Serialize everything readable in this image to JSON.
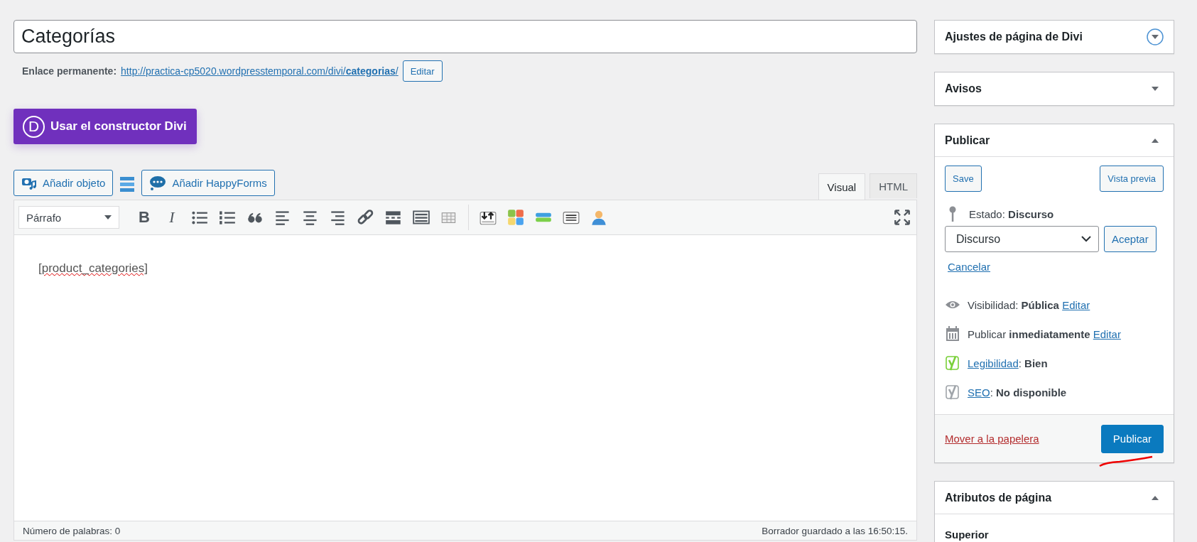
{
  "title_field": {
    "value": "Categorías"
  },
  "permalink": {
    "label": "Enlace permanente:",
    "url": "http://practica-cp5020.wordpresstemporal.com/divi/**categorias**/",
    "edit_button": "Editar"
  },
  "divi_button": {
    "logo_letter": "D",
    "label": "Usar el constructor Divi"
  },
  "media_buttons": [
    {
      "kind": "media",
      "label": "Añadir objeto"
    },
    {
      "kind": "layers"
    },
    {
      "kind": "forms",
      "label": "Añadir HappyForms"
    }
  ],
  "editor_tabs": [
    {
      "label": "Visual",
      "selected": true
    },
    {
      "label": "HTML",
      "selected": false
    }
  ],
  "format_select": {
    "value": "Párrafo"
  },
  "toolbar_buttons": [
    {
      "kind": "bold",
      "glyph": "B"
    },
    {
      "kind": "italic",
      "glyph": "I"
    },
    {
      "kind": "bullets"
    },
    {
      "kind": "numbers"
    },
    {
      "kind": "quote"
    },
    {
      "kind": "align-left"
    },
    {
      "kind": "align-center"
    },
    {
      "kind": "align-right"
    },
    {
      "kind": "link"
    },
    {
      "kind": "more"
    },
    {
      "kind": "toolbar-toggle"
    },
    {
      "kind": "table"
    },
    {
      "kind": "separator"
    },
    {
      "kind": "upload"
    },
    {
      "kind": "grid"
    },
    {
      "kind": "stack"
    },
    {
      "kind": "document"
    },
    {
      "kind": "person"
    }
  ],
  "content": "[product_categories]",
  "status_bar": {
    "word_count": "Número de palabras: 0",
    "draft_saved": "Borrador guardado a las 16:50:15."
  },
  "divi_settings_box": {
    "title": "Ajustes de página de Divi",
    "expanded": false,
    "focused": true
  },
  "notices_box": {
    "title": "Avisos",
    "expanded": false
  },
  "publish_box": {
    "title": "Publicar",
    "expanded": true,
    "save_button": "Save",
    "preview_button": "Vista previa",
    "status": "Estado: **Discurso**",
    "status_select": {
      "value": "Discurso"
    },
    "accept_button": "Aceptar",
    "cancel_link": "Cancelar",
    "visibility": {
      "text": "Visibilidad: **Pública**",
      "edit": "Editar"
    },
    "schedule": {
      "text": "Publicar **inmediatamente**",
      "edit": "Editar"
    },
    "seo_checks": [
      {
        "link": "Legibilidad",
        "value": ": **Bien**",
        "color": "#7ad03a"
      },
      {
        "link": "SEO",
        "value": ": **No disponible**",
        "color": "#a0a5aa"
      }
    ],
    "trash_link": "Mover a la papelera",
    "publish_button": "Publicar"
  },
  "page_attributes_box": {
    "title": "Atributos de página",
    "expanded": true,
    "parent_label": "Superior"
  }
}
